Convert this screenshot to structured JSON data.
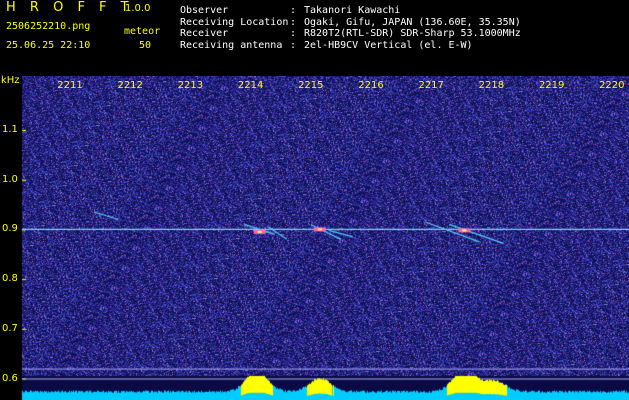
{
  "header": {
    "title": "H R O F F T",
    "version": "1.0.0",
    "filename": "2506252210.png",
    "count_type": "meteor",
    "datetime": "25.06.25 22:10",
    "count": "50"
  },
  "station_info": [
    {
      "key": "Observer",
      "value": "Takanori Kawachi"
    },
    {
      "key": "Receiving Location",
      "value": "Ogaki, Gifu, JAPAN (136.60E, 35.35N)"
    },
    {
      "key": "Receiver",
      "value": "R820T2(RTL-SDR) SDR-Sharp 53.1000MHz"
    },
    {
      "key": "Receiving antenna",
      "value": "2el-HB9CV Vertical (el. E-W)"
    }
  ],
  "colors": {
    "label": "#ffff00",
    "info_text": "#ffffff",
    "background_noise": "#1a1a6e",
    "carrier": "#66ddff",
    "amplitude_fill": "#00ccff",
    "amplitude_peak": "#ffff00"
  },
  "chart_data": {
    "type": "heatmap",
    "x_axis_ticks": [
      "2211",
      "2212",
      "2213",
      "2214",
      "2215",
      "2216",
      "2217",
      "2218",
      "2219",
      "2220"
    ],
    "y_axis_unit": "kHz",
    "y_axis_ticks": [
      "1.1",
      "1.0",
      "0.9",
      "0.8",
      "0.7",
      "0.6"
    ],
    "y_range_khz": [
      0.58,
      1.19
    ],
    "carrier_khz": 0.9,
    "meteor_traces": [
      {
        "x_start": 2211.4,
        "x_end": 2211.8,
        "khz_start": 0.935,
        "khz_end": 0.92
      },
      {
        "x_start": 2213.9,
        "x_end": 2214.4,
        "khz_start": 0.91,
        "khz_end": 0.89
      },
      {
        "x_start": 2214.3,
        "x_end": 2214.6,
        "khz_start": 0.905,
        "khz_end": 0.88
      },
      {
        "x_start": 2215.0,
        "x_end": 2215.5,
        "khz_start": 0.91,
        "khz_end": 0.88
      },
      {
        "x_start": 2215.3,
        "x_end": 2215.7,
        "khz_start": 0.898,
        "khz_end": 0.885
      },
      {
        "x_start": 2216.9,
        "x_end": 2217.8,
        "khz_start": 0.915,
        "khz_end": 0.875
      },
      {
        "x_start": 2217.3,
        "x_end": 2218.2,
        "khz_start": 0.91,
        "khz_end": 0.872
      }
    ],
    "meteor_bursts": [
      {
        "x": 2214.15,
        "khz": 0.895
      },
      {
        "x": 2215.15,
        "khz": 0.9
      },
      {
        "x": 2217.55,
        "khz": 0.898
      }
    ],
    "amplitude_peaks": [
      {
        "x": 2214.1,
        "level": 0.85
      },
      {
        "x": 2215.15,
        "level": 0.55
      },
      {
        "x": 2217.55,
        "level": 1.0
      },
      {
        "x": 2218.05,
        "level": 0.45
      }
    ],
    "amplitude_baseline": 0.3,
    "grid": false
  }
}
